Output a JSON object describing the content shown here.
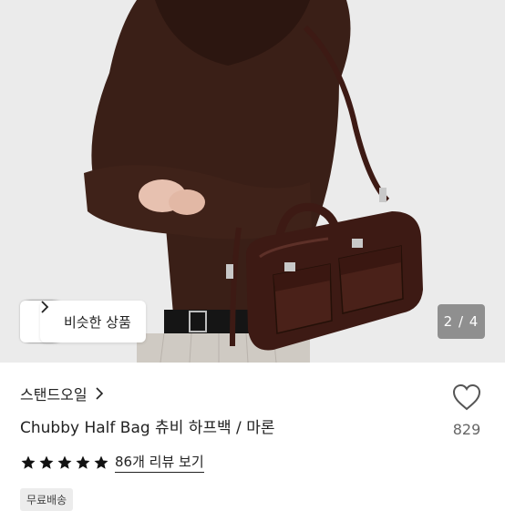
{
  "hero": {
    "similar_label": "비슷한 상품",
    "page_indicator": "2 / 4",
    "image_subject": "model-with-brown-half-bag"
  },
  "product": {
    "store_name": "스탠드오일",
    "title": "Chubby Half Bag 츄비 하프백 / 마론",
    "rating_stars": 5,
    "review_link": "86개 리뷰 보기",
    "wishlist_count": "829",
    "shipping_badge": "무료배송"
  },
  "colors": {
    "bag": "#3d1a14",
    "hoodie": "#3a1f17",
    "background": "#e9e9e9",
    "badge_bg": "#ececec",
    "star": "#111111"
  },
  "icons": {
    "chevron": "chevron-right-icon",
    "heart": "heart-outline-icon",
    "star": "star-icon"
  }
}
